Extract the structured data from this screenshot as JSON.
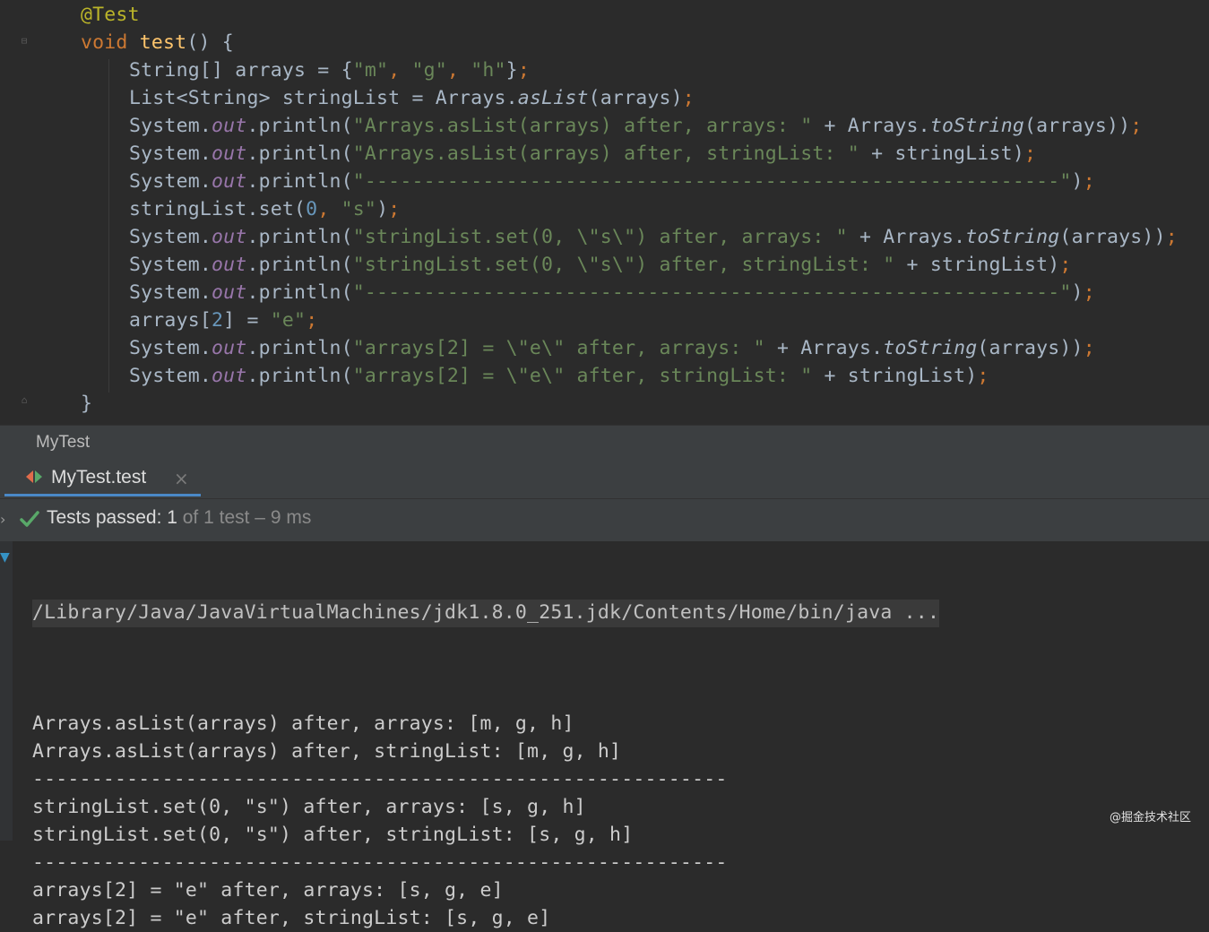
{
  "editor": {
    "code_lines": [
      {
        "indent": 1,
        "tokens": [
          {
            "t": "@Test",
            "c": "ann"
          }
        ]
      },
      {
        "indent": 1,
        "tokens": [
          {
            "t": "void",
            "c": "kw"
          },
          {
            "t": " "
          },
          {
            "t": "test",
            "c": "fn"
          },
          {
            "t": "() {"
          }
        ]
      },
      {
        "indent": 2,
        "tokens": [
          {
            "t": "String[] arrays = {"
          },
          {
            "t": "\"m\"",
            "c": "str"
          },
          {
            "t": ", ",
            "c": "kw"
          },
          {
            "t": "\"g\"",
            "c": "str"
          },
          {
            "t": ", ",
            "c": "kw"
          },
          {
            "t": "\"h\"",
            "c": "str"
          },
          {
            "t": "}"
          },
          {
            "t": ";",
            "c": "kw"
          }
        ]
      },
      {
        "indent": 2,
        "tokens": [
          {
            "t": "List<String> stringList = Arrays."
          },
          {
            "t": "asList",
            "c": "stat"
          },
          {
            "t": "(arrays)"
          },
          {
            "t": ";",
            "c": "kw"
          }
        ]
      },
      {
        "indent": 2,
        "tokens": [
          {
            "t": "System."
          },
          {
            "t": "out",
            "c": "fld"
          },
          {
            "t": ".println("
          },
          {
            "t": "\"Arrays.asList(arrays) after, arrays: \"",
            "c": "str"
          },
          {
            "t": " + Arrays."
          },
          {
            "t": "toString",
            "c": "stat"
          },
          {
            "t": "(arrays))"
          },
          {
            "t": ";",
            "c": "kw"
          }
        ]
      },
      {
        "indent": 2,
        "tokens": [
          {
            "t": "System."
          },
          {
            "t": "out",
            "c": "fld"
          },
          {
            "t": ".println("
          },
          {
            "t": "\"Arrays.asList(arrays) after, stringList: \"",
            "c": "str"
          },
          {
            "t": " + stringList)"
          },
          {
            "t": ";",
            "c": "kw"
          }
        ]
      },
      {
        "indent": 2,
        "tokens": [
          {
            "t": "System."
          },
          {
            "t": "out",
            "c": "fld"
          },
          {
            "t": ".println("
          },
          {
            "t": "\"-----------------------------------------------------------\"",
            "c": "str"
          },
          {
            "t": ")"
          },
          {
            "t": ";",
            "c": "kw"
          }
        ]
      },
      {
        "indent": 2,
        "tokens": [
          {
            "t": "stringList.set("
          },
          {
            "t": "0",
            "c": "num"
          },
          {
            "t": ", ",
            "c": "kw"
          },
          {
            "t": "\"s\"",
            "c": "str"
          },
          {
            "t": ")"
          },
          {
            "t": ";",
            "c": "kw"
          }
        ]
      },
      {
        "indent": 2,
        "tokens": [
          {
            "t": "System."
          },
          {
            "t": "out",
            "c": "fld"
          },
          {
            "t": ".println("
          },
          {
            "t": "\"stringList.set(0, \\\"s\\\") after, arrays: \"",
            "c": "str"
          },
          {
            "t": " + Arrays."
          },
          {
            "t": "toString",
            "c": "stat"
          },
          {
            "t": "(arrays))"
          },
          {
            "t": ";",
            "c": "kw"
          }
        ]
      },
      {
        "indent": 2,
        "tokens": [
          {
            "t": "System."
          },
          {
            "t": "out",
            "c": "fld"
          },
          {
            "t": ".println("
          },
          {
            "t": "\"stringList.set(0, \\\"s\\\") after, stringList: \"",
            "c": "str"
          },
          {
            "t": " + stringList)"
          },
          {
            "t": ";",
            "c": "kw"
          }
        ]
      },
      {
        "indent": 2,
        "tokens": [
          {
            "t": "System."
          },
          {
            "t": "out",
            "c": "fld"
          },
          {
            "t": ".println("
          },
          {
            "t": "\"-----------------------------------------------------------\"",
            "c": "str"
          },
          {
            "t": ")"
          },
          {
            "t": ";",
            "c": "kw"
          }
        ]
      },
      {
        "indent": 2,
        "tokens": [
          {
            "t": "arrays["
          },
          {
            "t": "2",
            "c": "num"
          },
          {
            "t": "] = "
          },
          {
            "t": "\"e\"",
            "c": "str"
          },
          {
            "t": ";",
            "c": "kw"
          }
        ]
      },
      {
        "indent": 2,
        "tokens": [
          {
            "t": "System."
          },
          {
            "t": "out",
            "c": "fld"
          },
          {
            "t": ".println("
          },
          {
            "t": "\"arrays[2] = \\\"e\\\" after, arrays: \"",
            "c": "str"
          },
          {
            "t": " + Arrays."
          },
          {
            "t": "toString",
            "c": "stat"
          },
          {
            "t": "(arrays))"
          },
          {
            "t": ";",
            "c": "kw"
          }
        ]
      },
      {
        "indent": 2,
        "tokens": [
          {
            "t": "System."
          },
          {
            "t": "out",
            "c": "fld"
          },
          {
            "t": ".println("
          },
          {
            "t": "\"arrays[2] = \\\"e\\\" after, stringList: \"",
            "c": "str"
          },
          {
            "t": " + stringList)"
          },
          {
            "t": ";",
            "c": "kw"
          }
        ]
      },
      {
        "indent": 1,
        "tokens": [
          {
            "t": "}"
          }
        ]
      }
    ]
  },
  "file_tab": {
    "label": "MyTest"
  },
  "run_tab": {
    "label": "MyTest.test",
    "close_glyph": "×"
  },
  "status": {
    "expand_glyph": "›",
    "passed_label": "Tests passed: 1",
    "detail": " of 1 test – 9 ms"
  },
  "console": {
    "command_line": "/Library/Java/JavaVirtualMachines/jdk1.8.0_251.jdk/Contents/Home/bin/java ...",
    "output_lines": [
      "",
      "Arrays.asList(arrays) after, arrays: [m, g, h]",
      "Arrays.asList(arrays) after, stringList: [m, g, h]",
      "-----------------------------------------------------------",
      "stringList.set(0, \"s\") after, arrays: [s, g, h]",
      "stringList.set(0, \"s\") after, stringList: [s, g, h]",
      "-----------------------------------------------------------",
      "arrays[2] = \"e\" after, arrays: [s, g, e]",
      "arrays[2] = \"e\" after, stringList: [s, g, e]"
    ]
  },
  "watermark": {
    "text": "@掘金技术社区"
  },
  "colors": {
    "keyword": "#cc7832",
    "annotation": "#bbb529",
    "function": "#ffc66d",
    "string": "#6a8759",
    "number": "#6897bb",
    "field": "#9876aa",
    "pass_check": "#59a869",
    "tab_underline": "#4a88c7"
  }
}
